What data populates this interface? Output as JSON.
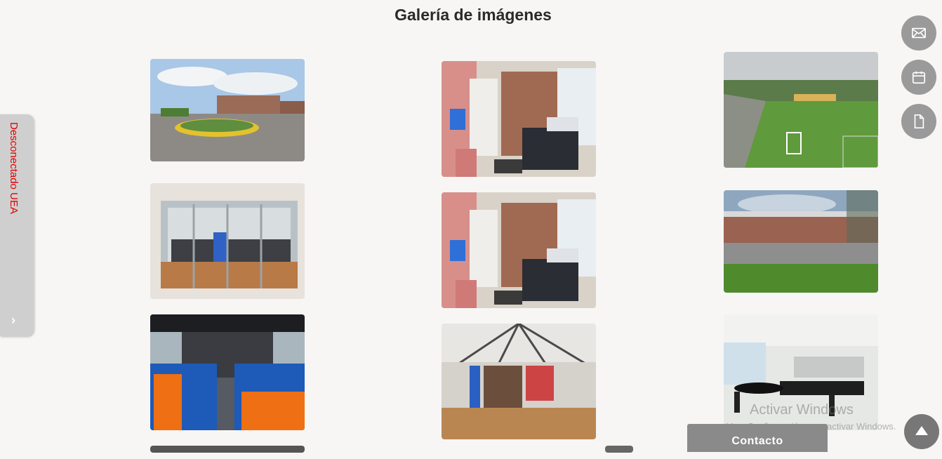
{
  "gallery": {
    "title": "Galería de imágenes",
    "images": [
      "campus-roundabout-photo",
      "office-room-photo",
      "soccer-field-photo",
      "glass-doors-library-photo",
      "office-room-photo",
      "campus-building-lawn-photo",
      "bus-interior-photo",
      "library-interior-photo",
      "laboratory-photo"
    ]
  },
  "side_tab": {
    "label": "Desconectado UEA",
    "chevron": "›"
  },
  "fabs": [
    {
      "icon": "mail-icon"
    },
    {
      "icon": "calendar-icon"
    },
    {
      "icon": "document-icon"
    }
  ],
  "contact": {
    "label": "Contacto"
  },
  "watermark": {
    "line1": "Activar Windows",
    "line2": "Ve a Configuración para activar Windows."
  },
  "colors": {
    "side_label": "#e00000",
    "fab": "#9a9a9a",
    "contact": "#8a8a8a"
  }
}
